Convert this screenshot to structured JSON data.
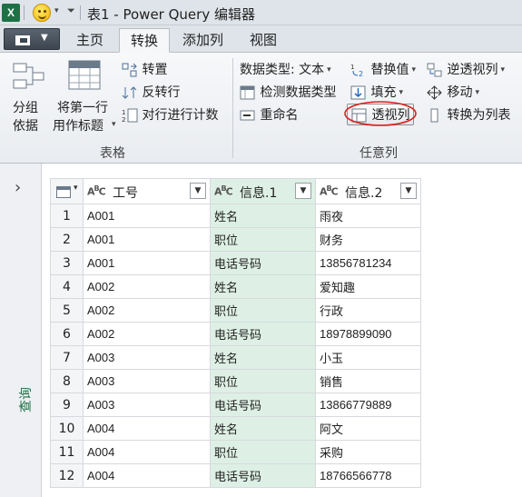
{
  "titlebar": {
    "app_icon": "X",
    "title": "表1 - Power Query 编辑器"
  },
  "tabs": [
    {
      "label": "主页",
      "active": false
    },
    {
      "label": "转换",
      "active": true
    },
    {
      "label": "添加列",
      "active": false
    },
    {
      "label": "视图",
      "active": false
    }
  ],
  "ribbon": {
    "group_by": {
      "line1": "分组",
      "line2": "依据"
    },
    "use_first_row": {
      "line1": "将第一行",
      "line2": "用作标题"
    },
    "transpose": "转置",
    "reverse_rows": "反转行",
    "count_rows": "对行进行计数",
    "table_group_label": "表格",
    "data_type": "数据类型: 文本",
    "detect_type": "检测数据类型",
    "rename": "重命名",
    "replace_values": "替换值",
    "fill": "填充",
    "pivot_column": "透视列",
    "unpivot_columns": "逆透视列",
    "move": "移动",
    "convert_to_list": "转换为列表",
    "any_column_group_label": "任意列"
  },
  "leftpane": {
    "label": "查询"
  },
  "grid": {
    "columns": [
      {
        "label": "工号"
      },
      {
        "label": "信息.1"
      },
      {
        "label": "信息.2"
      }
    ],
    "rows": [
      [
        "1",
        "A001",
        "姓名",
        "雨夜"
      ],
      [
        "2",
        "A001",
        "职位",
        "财务"
      ],
      [
        "3",
        "A001",
        "电话号码",
        "13856781234"
      ],
      [
        "4",
        "A002",
        "姓名",
        "爱知趣"
      ],
      [
        "5",
        "A002",
        "职位",
        "行政"
      ],
      [
        "6",
        "A002",
        "电话号码",
        "18978899090"
      ],
      [
        "7",
        "A003",
        "姓名",
        "小玉"
      ],
      [
        "8",
        "A003",
        "职位",
        "销售"
      ],
      [
        "9",
        "A003",
        "电话号码",
        "13866779889"
      ],
      [
        "10",
        "A004",
        "姓名",
        "阿文"
      ],
      [
        "11",
        "A004",
        "职位",
        "采购"
      ],
      [
        "12",
        "A004",
        "电话号码",
        "18766566778"
      ]
    ]
  },
  "colors": {
    "selected_column": "#def0e6",
    "accent_green": "#1e7145",
    "highlight_circle": "#d9231f"
  }
}
